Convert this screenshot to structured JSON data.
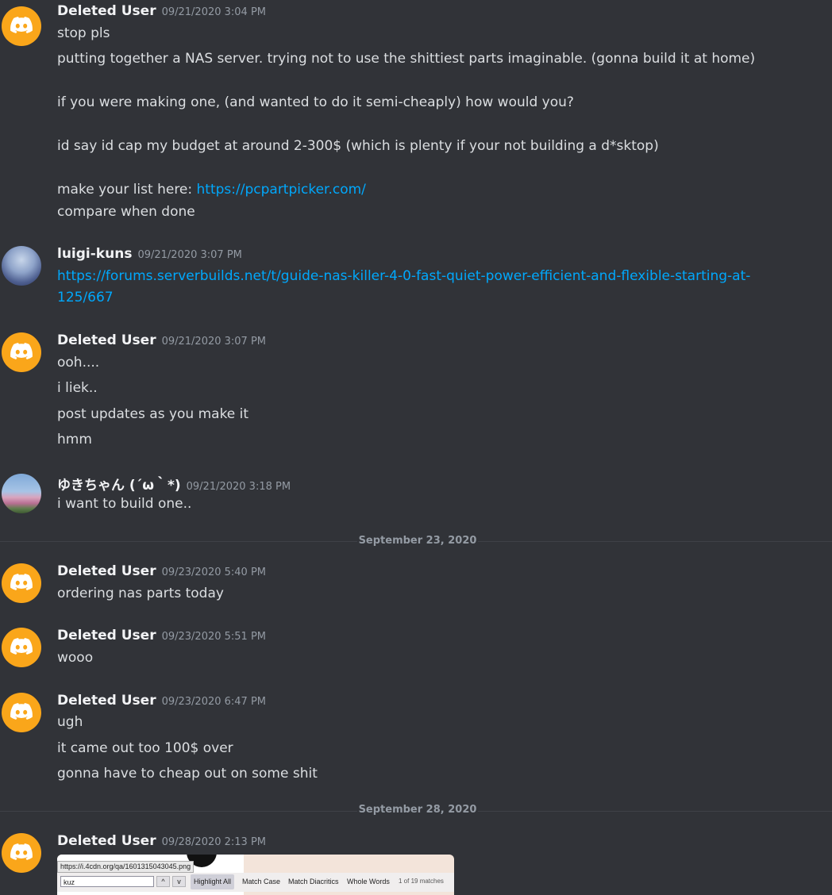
{
  "messages": [
    {
      "username": "Deleted User",
      "timestamp": "09/21/2020 3:04 PM",
      "lines": [
        "stop pls",
        "putting together a NAS server. trying not to use the shittiest parts imaginable. (gonna build it at home)",
        "if you were making one, (and wanted to do it semi-cheaply) how would you?",
        "id say id cap my budget at around 2-300$ (which is plenty if your not building a d*sktop)"
      ],
      "link_prefix": "make your list here: ",
      "link": "https://pcpartpicker.com/",
      "after_link": "compare when done"
    },
    {
      "username": "luigi-kuns",
      "timestamp": "09/21/2020 3:07 PM",
      "link_line1": "https://forums.serverbuilds.net/t/guide-nas-killer-4-0-fast-quiet-power-efficient-and-flexible-starting-at-",
      "link_line2": "125/667"
    },
    {
      "username": "Deleted User",
      "timestamp": "09/21/2020 3:07 PM",
      "lines": [
        "ooh....",
        "i liek..",
        "post updates as you make it",
        "hmm"
      ]
    },
    {
      "username": "ゆきちゃん (´ω｀*)",
      "timestamp": "09/21/2020 3:18 PM",
      "lines": [
        "i want to build one.."
      ]
    },
    {
      "username": "Deleted User",
      "timestamp": "09/23/2020 5:40 PM",
      "lines": [
        "ordering nas parts today"
      ]
    },
    {
      "username": "Deleted User",
      "timestamp": "09/23/2020 5:51 PM",
      "lines": [
        "wooo"
      ]
    },
    {
      "username": "Deleted User",
      "timestamp": "09/23/2020 6:47 PM",
      "lines": [
        "ugh",
        "it came out too 100$ over",
        "gonna have to cheap out on some shit"
      ]
    },
    {
      "username": "Deleted User",
      "timestamp": "09/28/2020 2:13 PM"
    }
  ],
  "dividers": [
    "September 23, 2020",
    "September 28, 2020"
  ],
  "image_preview": {
    "url": "https://i.4cdn.org/qa/1601315043045.png"
  },
  "findbar": {
    "query": "kuz",
    "prev": "^",
    "next": "v",
    "highlight_all": "Highlight All",
    "match_case": "Match Case",
    "match_diacritics": "Match Diacritics",
    "whole_words": "Whole Words",
    "status": "1 of 19 matches"
  }
}
